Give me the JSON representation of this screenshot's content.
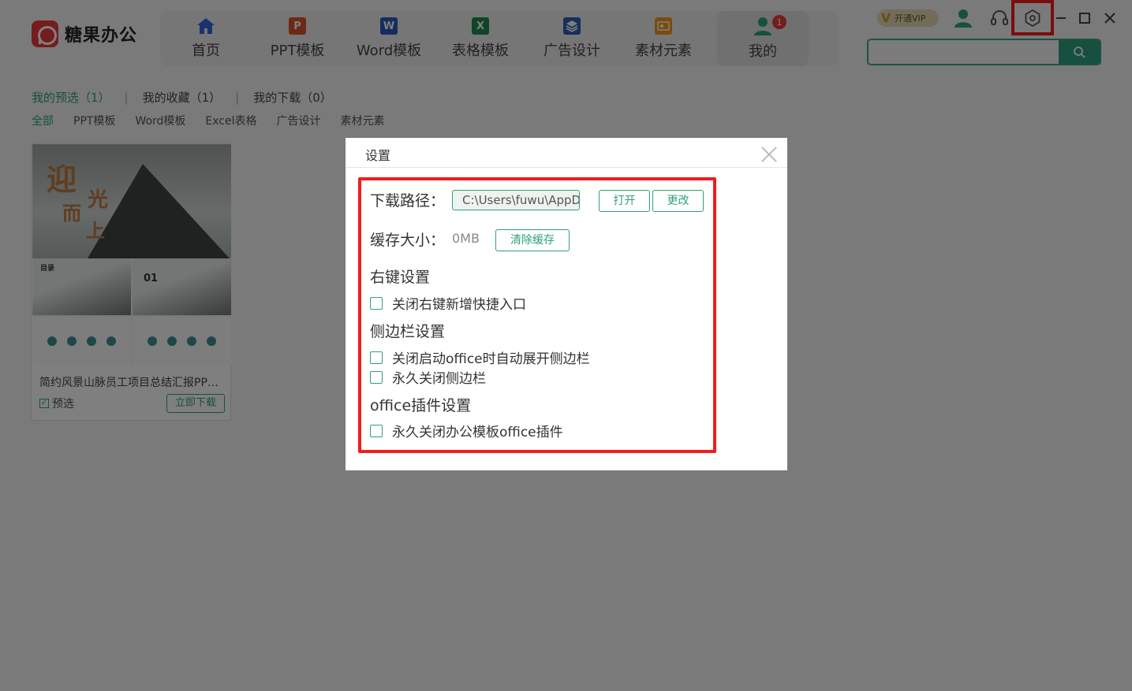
{
  "app": {
    "name": "糖果办公"
  },
  "nav": {
    "items": [
      {
        "label": "首页",
        "icon": "home-icon",
        "color": "#2f6bd8"
      },
      {
        "label": "PPT模板",
        "icon": "ppt-icon",
        "color": "#d9532c",
        "glyph": "P"
      },
      {
        "label": "Word模板",
        "icon": "word-icon",
        "color": "#2b5bb8",
        "glyph": "W"
      },
      {
        "label": "表格模板",
        "icon": "excel-icon",
        "color": "#1f8a4c",
        "glyph": "X"
      },
      {
        "label": "广告设计",
        "icon": "layers-icon",
        "color": "#2c5fb6"
      },
      {
        "label": "素材元素",
        "icon": "material-icon",
        "color": "#f29a1f"
      },
      {
        "label": "我的",
        "icon": "user-icon",
        "color": "#2fa07f",
        "badge": "1"
      }
    ]
  },
  "topbar": {
    "vip_label": "开通VIP",
    "search_placeholder": ""
  },
  "tabs": {
    "preselect": "我的预选（1）",
    "favorites": "我的收藏（1）",
    "downloads": "我的下载（0）",
    "separator": "|"
  },
  "filters": [
    "全部",
    "PPT模板",
    "Word模板",
    "Excel表格",
    "广告设计",
    "素材元素"
  ],
  "card": {
    "title": "简约风景山脉员工项目总结汇报PP…",
    "check_label": "预选",
    "download_label": "立即下载",
    "thumb_calligraphy": [
      "迎",
      "光",
      "而",
      "上"
    ],
    "thumb_index": "01",
    "thumb_toc": "目录"
  },
  "dialog": {
    "title": "设置",
    "download_path_label": "下载路径：",
    "download_path_value": "C:\\Users\\fuwu\\AppDa",
    "open_label": "打开",
    "change_label": "更改",
    "cache_label": "缓存大小：",
    "cache_value": "0MB",
    "clear_cache_label": "清除缓存",
    "context_menu_title": "右键设置",
    "context_menu_opt": "关闭右键新增快捷入口",
    "sidebar_title": "侧边栏设置",
    "sidebar_opt1": "关闭启动office时自动展开侧边栏",
    "sidebar_opt2": "永久关闭侧边栏",
    "plugin_title": "office插件设置",
    "plugin_opt": "永久关闭办公模板office插件"
  },
  "colors": {
    "accent": "#2fa07f",
    "highlight": "#f21c1c",
    "brand": "#e8383d"
  }
}
